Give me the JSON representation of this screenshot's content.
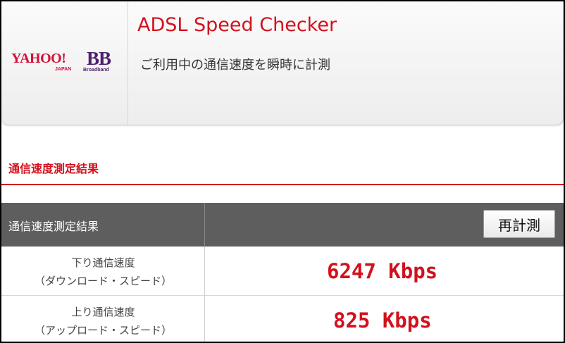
{
  "header": {
    "logo": {
      "yahoo": "YAHOO!",
      "bb": "BB",
      "japan": "JAPAN",
      "broadband": "Broadband"
    },
    "title": "ADSL Speed Checker",
    "subtitle": "ご利用中の通信速度を瞬時に計測"
  },
  "section": {
    "title": "通信速度測定結果"
  },
  "results": {
    "header_label": "通信速度測定結果",
    "remeasure_label": "再計測",
    "rows": [
      {
        "label_line1": "下り通信速度",
        "label_line2": "（ダウンロード・スピード）",
        "value": "6247 Kbps"
      },
      {
        "label_line1": "上り通信速度",
        "label_line2": "（アップロード・スピード）",
        "value": "825 Kbps"
      }
    ]
  },
  "colors": {
    "accent": "#d2111d",
    "table_header": "#5e5e5e",
    "logo_red": "#d2113a",
    "logo_purple": "#4d1f6e"
  }
}
